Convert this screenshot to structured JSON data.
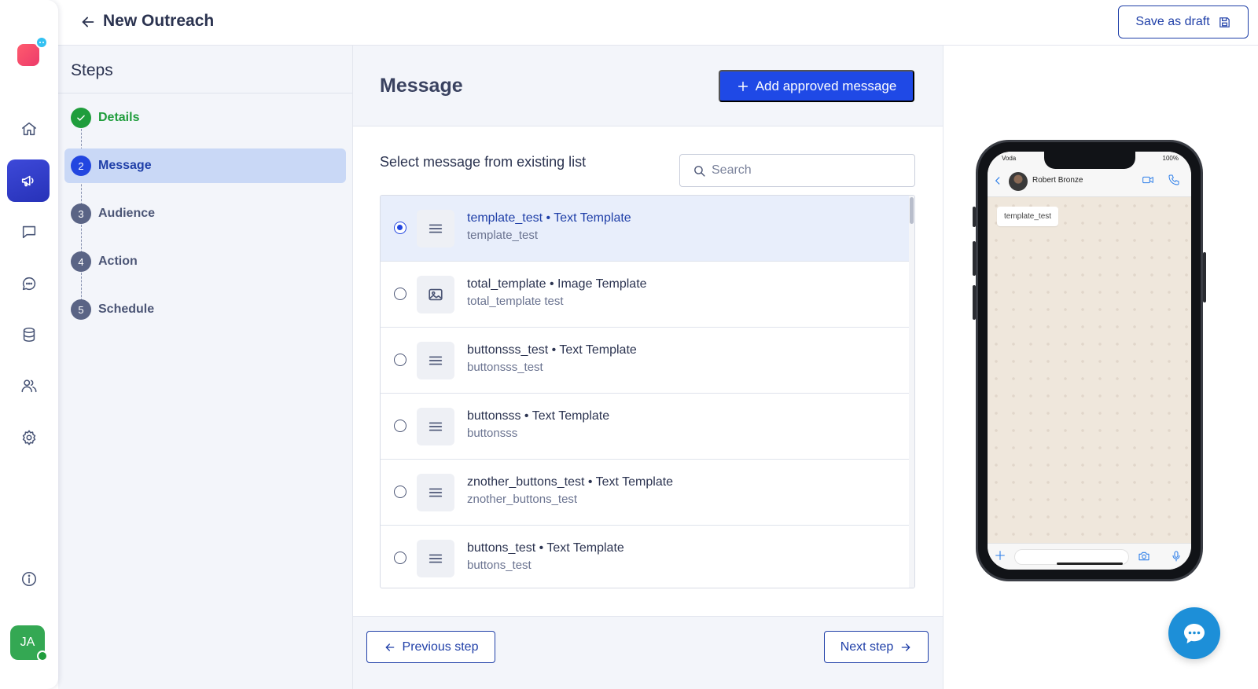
{
  "header": {
    "title": "New Outreach",
    "save_draft_label": "Save as draft"
  },
  "steps": {
    "title": "Steps",
    "items": [
      {
        "number": "",
        "label": "Details",
        "state": "done"
      },
      {
        "number": "2",
        "label": "Message",
        "state": "current"
      },
      {
        "number": "3",
        "label": "Audience",
        "state": "pending"
      },
      {
        "number": "4",
        "label": "Action",
        "state": "pending"
      },
      {
        "number": "5",
        "label": "Schedule",
        "state": "pending"
      }
    ]
  },
  "message": {
    "title": "Message",
    "add_button_label": "Add approved message",
    "select_label": "Select message from existing list",
    "search_placeholder": "Search",
    "templates": [
      {
        "title": "template_test • Text Template",
        "subtitle": "template_test",
        "icon": "text-lines-icon",
        "selected": true
      },
      {
        "title": "total_template • Image Template",
        "subtitle": "total_template test",
        "icon": "image-icon",
        "selected": false
      },
      {
        "title": "buttonsss_test • Text Template",
        "subtitle": "buttonsss_test",
        "icon": "text-lines-icon",
        "selected": false
      },
      {
        "title": "buttonsss • Text Template",
        "subtitle": "buttonsss",
        "icon": "text-lines-icon",
        "selected": false
      },
      {
        "title": "znother_buttons_test • Text Template",
        "subtitle": "znother_buttons_test",
        "icon": "text-lines-icon",
        "selected": false
      },
      {
        "title": "buttons_test • Text Template",
        "subtitle": "buttons_test",
        "icon": "text-lines-icon",
        "selected": false
      }
    ],
    "prev_label": "Previous step",
    "next_label": "Next step"
  },
  "preview": {
    "carrier": "Voda",
    "battery": "100%",
    "contact_name": "Robert Bronze",
    "bubble_text": "template_test"
  },
  "user": {
    "initials": "JA"
  },
  "colors": {
    "primary": "#1f49e6",
    "nav_active": "#2f3bc9",
    "success": "#1f9d3c",
    "step_active_bg": "#c9d8f6",
    "chat_fab": "#1d8fd8"
  }
}
